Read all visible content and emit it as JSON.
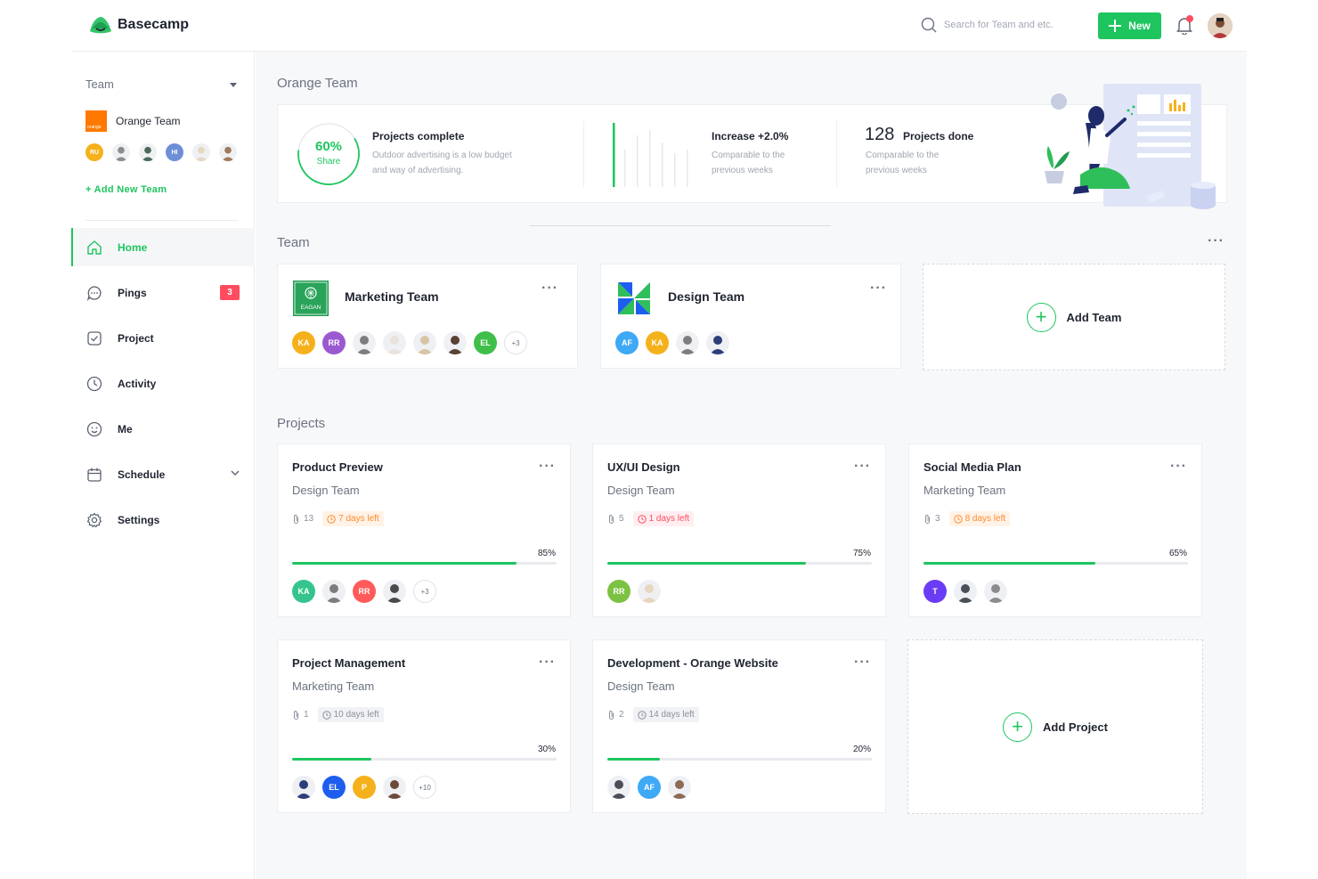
{
  "app": {
    "name": "Basecamp"
  },
  "header": {
    "search_placeholder": "Search for Team and etc.",
    "new_label": "New"
  },
  "sidebar": {
    "team_label": "Team",
    "team_name": "Orange Team",
    "team_logo_text": "orange",
    "members": [
      {
        "initials": "RU",
        "color": "#f5b11c"
      },
      {
        "initials": "",
        "color": "#8c8c8c"
      },
      {
        "initials": "",
        "color": "#4b6a5a"
      },
      {
        "initials": "HI",
        "color": "#6e8fd6"
      },
      {
        "initials": "",
        "color": "#e8d6c0"
      },
      {
        "initials": "",
        "color": "#a07a5e"
      }
    ],
    "add_team": "+ Add New Team",
    "nav": [
      {
        "label": "Home",
        "icon": "home-icon"
      },
      {
        "label": "Pings",
        "icon": "chat-icon",
        "badge": "3"
      },
      {
        "label": "Project",
        "icon": "check-square-icon"
      },
      {
        "label": "Activity",
        "icon": "clock-icon"
      },
      {
        "label": "Me",
        "icon": "smile-icon"
      },
      {
        "label": "Schedule",
        "icon": "calendar-icon"
      },
      {
        "label": "Settings",
        "icon": "gear-icon"
      }
    ]
  },
  "main": {
    "title": "Orange Team",
    "stats": {
      "ring_value": "60%",
      "ring_fraction": 0.6,
      "ring_label": "Share",
      "projects_complete": {
        "title": "Projects complete",
        "desc1": "Outdoor advertising is a low budget",
        "desc2": "and way of advertising."
      },
      "increase": {
        "title": "Increase +2.0%",
        "desc1": "Comparable to the",
        "desc2": "previous weeks"
      },
      "done": {
        "number": "128",
        "title": "Projects done",
        "desc1": "Comparable to the",
        "desc2": "previous weeks"
      }
    },
    "team_section": "Team",
    "teams": [
      {
        "name": "Marketing Team",
        "logo_text": "EAGAN",
        "members": [
          {
            "initials": "KA",
            "color": "#f5b11c"
          },
          {
            "initials": "RR",
            "color": "#9b59d0"
          },
          {
            "initials": "",
            "color": "#7d7d7d"
          },
          {
            "initials": "",
            "color": "#e9e2dc"
          },
          {
            "initials": "",
            "color": "#d9c3a5"
          },
          {
            "initials": "",
            "color": "#5a4035"
          },
          {
            "initials": "EL",
            "color": "#3fbf4a"
          }
        ],
        "more": "+3"
      },
      {
        "name": "Design Team",
        "members": [
          {
            "initials": "AF",
            "color": "#3ea9f5"
          },
          {
            "initials": "KA",
            "color": "#f5b11c"
          },
          {
            "initials": "",
            "color": "#7d7d7d"
          },
          {
            "initials": "",
            "color": "#2c3e7a"
          }
        ]
      }
    ],
    "add_team_label": "Add Team",
    "projects_section": "Projects",
    "projects": [
      {
        "title": "Product Preview",
        "team": "Design Team",
        "attachments": "13",
        "days": "7 days left",
        "days_style": "orange",
        "percent": "85%",
        "progress": 0.85,
        "members": [
          {
            "initials": "KA",
            "color": "#35c48d"
          },
          {
            "initials": "",
            "color": "#7d7d7d"
          },
          {
            "initials": "RR",
            "color": "#ff5a5a"
          },
          {
            "initials": "",
            "color": "#4a4a4a"
          }
        ],
        "more": "+3"
      },
      {
        "title": "UX/UI Design",
        "team": "Design Team",
        "attachments": "5",
        "days": "1 days left",
        "days_style": "red",
        "percent": "75%",
        "progress": 0.75,
        "members": [
          {
            "initials": "RR",
            "color": "#7cc242"
          },
          {
            "initials": "",
            "color": "#e8d6c0"
          }
        ]
      },
      {
        "title": "Social Media Plan",
        "team": "Marketing Team",
        "attachments": "3",
        "days": "8 days left",
        "days_style": "orange",
        "percent": "65%",
        "progress": 0.65,
        "members": [
          {
            "initials": "T",
            "color": "#6b3cf5"
          },
          {
            "initials": "",
            "color": "#4b4f57"
          },
          {
            "initials": "",
            "color": "#8c8c8c"
          }
        ]
      },
      {
        "title": "Project Management",
        "team": "Marketing Team",
        "attachments": "1",
        "days": "10 days left",
        "days_style": "gray",
        "percent": "30%",
        "progress": 0.3,
        "members": [
          {
            "initials": "",
            "color": "#2c3e7a"
          },
          {
            "initials": "EL",
            "color": "#1e5eef"
          },
          {
            "initials": "P",
            "color": "#f5b11c"
          },
          {
            "initials": "",
            "color": "#6b4a3a"
          }
        ],
        "more": "+10"
      },
      {
        "title": "Development - Orange Website",
        "team": "Design Team",
        "attachments": "2",
        "days": "14 days left",
        "days_style": "gray",
        "percent": "20%",
        "progress": 0.2,
        "members": [
          {
            "initials": "",
            "color": "#4b4f57"
          },
          {
            "initials": "AF",
            "color": "#3ea9f5"
          },
          {
            "initials": "",
            "color": "#8c6a55"
          }
        ]
      }
    ],
    "add_project_label": "Add Project"
  }
}
